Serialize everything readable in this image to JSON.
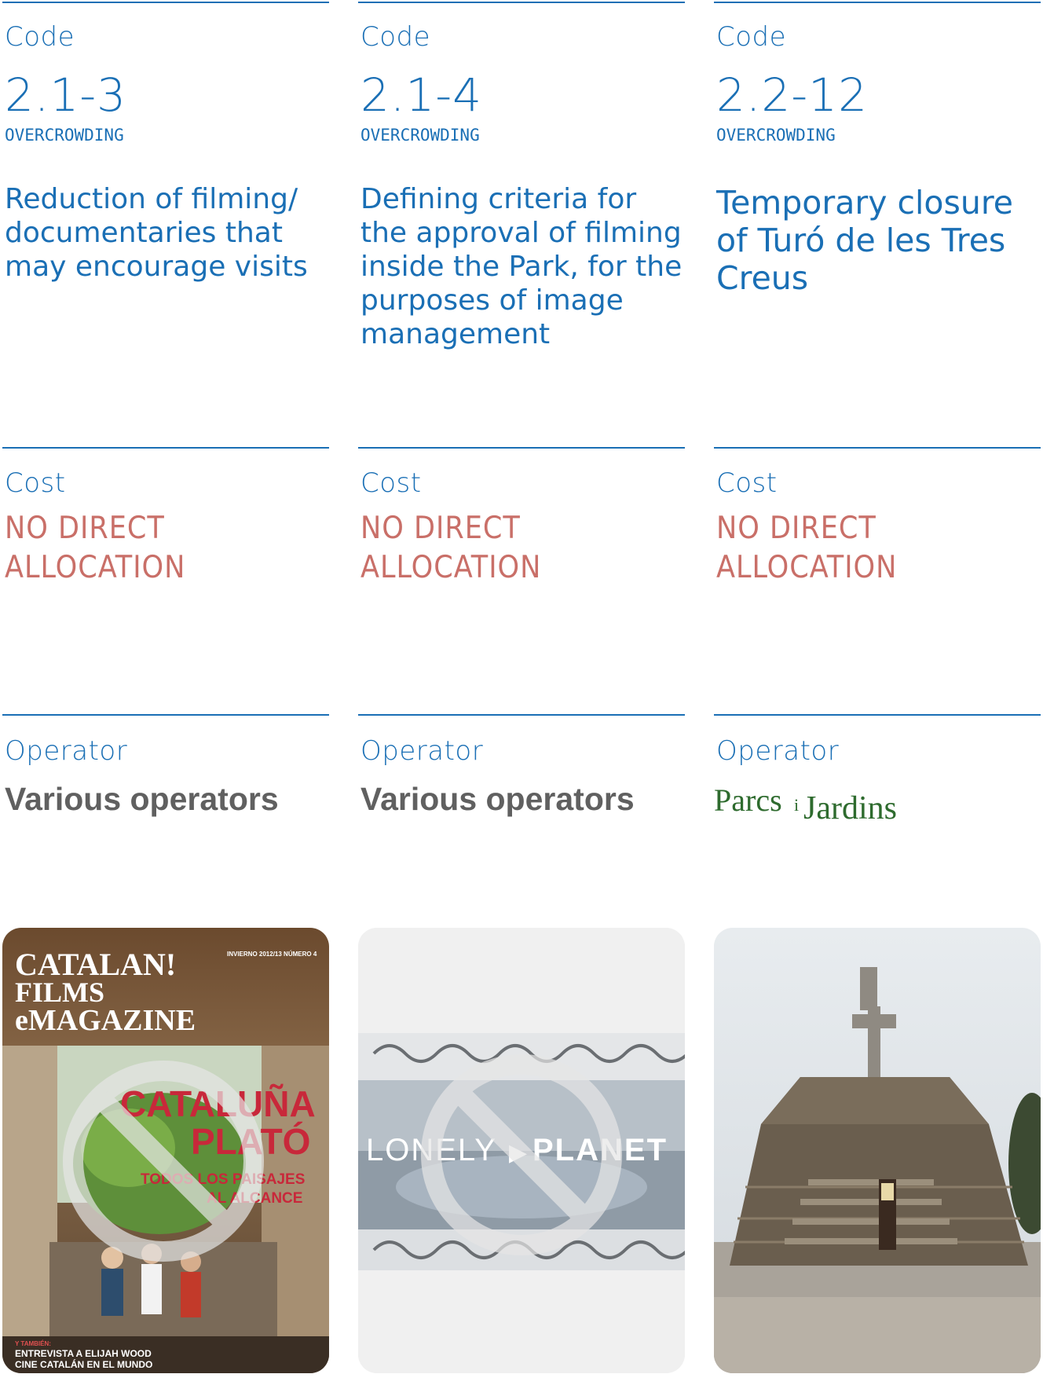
{
  "labels": {
    "code": "Code",
    "cost": "Cost",
    "operator": "Operator"
  },
  "colors": {
    "accent_blue": "#1a6fb5",
    "cost_red": "#c96f68",
    "operator_gray": "#606060",
    "logo_green": "#2e6b2e"
  },
  "measures": [
    {
      "code": "2.1-3",
      "category": "OVERCROWDING",
      "title": "Reduction of filming/ documentaries that may encourage visits",
      "cost": "NO DIRECT ALLOCATION",
      "operator": "Various operators",
      "image": {
        "kind": "magazine-cover",
        "masthead_line1": "CATALAN!",
        "masthead_line2": "FILMS",
        "masthead_line3": "eMAGAZINE",
        "issue": "INVIERNO 2012/13 NÚMERO 4",
        "headline1": "CATALUÑA",
        "headline2": "PLATÓ",
        "subhead1": "TODOS LOS PAISAJES",
        "subhead2": "AL ALCANCE",
        "footer_tag": "Y TAMBIÉN:",
        "footer1": "ENTREVISTA A ELIJAH WOOD",
        "footer2": "CINE CATALÁN EN EL MUNDO",
        "overlay": "prohibited-icon"
      }
    },
    {
      "code": "2.1-4",
      "category": "OVERCROWDING",
      "title": "Defining criteria for the approval of filming inside the Park, for the purposes of image management",
      "cost": "NO DIRECT ALLOCATION",
      "operator": "Various operators",
      "image": {
        "kind": "video-still",
        "brand_left": "LONELY",
        "brand_right": "PLANET",
        "overlay": "prohibited-icon"
      }
    },
    {
      "code": "2.2-12",
      "category": "OVERCROWDING",
      "title": "Temporary closure of Turó de les Tres Creus",
      "cost": "NO DIRECT ALLOCATION",
      "operator_logo": {
        "word1": "Parcs",
        "connector": "i",
        "word2": "Jardins"
      },
      "image": {
        "kind": "photo",
        "subject": "stone-mound-monument"
      }
    }
  ]
}
